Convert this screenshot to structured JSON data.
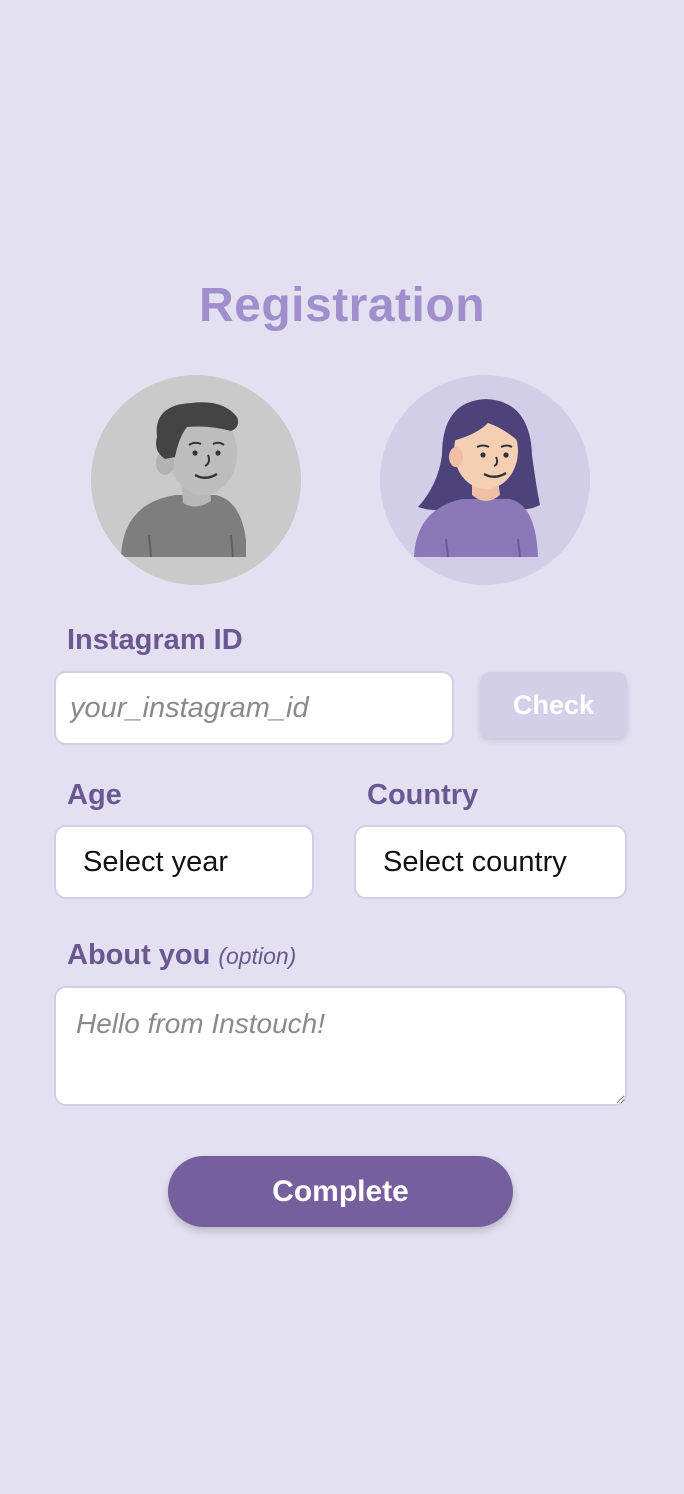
{
  "title": "Registration",
  "avatars": {
    "male": {
      "icon": "male-avatar-icon",
      "bg": "#cacaca"
    },
    "female": {
      "icon": "female-avatar-icon",
      "bg": "#d3cee7"
    }
  },
  "instagram": {
    "label": "Instagram ID",
    "placeholder": "your_instagram_id",
    "check_label": "Check"
  },
  "age": {
    "label": "Age",
    "value": "Select year"
  },
  "country": {
    "label": "Country",
    "value": "Select country"
  },
  "about": {
    "label": "About you",
    "optional_note": "(option)",
    "placeholder": "Hello from Instouch!"
  },
  "complete_label": "Complete",
  "colors": {
    "background": "#e3e0f1",
    "title": "#a08fcd",
    "label": "#6a5890",
    "primary": "#765f9d",
    "check_button": "#d4cfe8"
  }
}
